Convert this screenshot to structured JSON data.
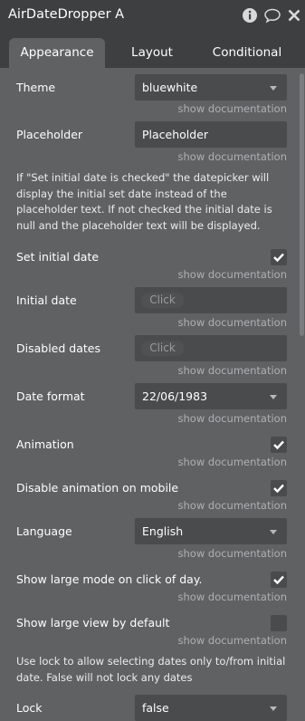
{
  "header": {
    "title": "AirDateDropper A"
  },
  "tabs": [
    {
      "label": "Appearance",
      "active": true
    },
    {
      "label": "Layout",
      "active": false
    },
    {
      "label": "Conditional",
      "active": false
    }
  ],
  "doc_link": "show documentation",
  "fields": {
    "theme": {
      "label": "Theme",
      "value": "bluewhite"
    },
    "placeholder": {
      "label": "Placeholder",
      "value": "Placeholder"
    },
    "placeholder_note": "If \"Set initial date is checked\" the datepicker will display the initial set date instead of the placeholder text. If not checked the initial date is null and the placeholder text will be displayed.",
    "set_initial_date": {
      "label": "Set initial date",
      "checked": true
    },
    "initial_date": {
      "label": "Initial date",
      "button": "Click"
    },
    "disabled_dates": {
      "label": "Disabled dates",
      "button": "Click"
    },
    "date_format": {
      "label": "Date format",
      "value": "22/06/1983"
    },
    "animation": {
      "label": "Animation",
      "checked": true
    },
    "disable_animation_mobile": {
      "label": "Disable animation on mobile",
      "checked": true
    },
    "language": {
      "label": "Language",
      "value": "English"
    },
    "show_large_mode": {
      "label": "Show large mode on click of day.",
      "checked": true
    },
    "show_large_view": {
      "label": "Show large view by default",
      "checked": false
    },
    "lock_note": "Use lock to allow selecting dates only to/from initial date. False will not lock any dates",
    "lock": {
      "label": "Lock",
      "value": "false"
    }
  },
  "colors": {
    "header_bg": "#3e3f41",
    "panel_bg": "#5f6163",
    "field_bg": "#4a4b4d",
    "doc_text": "#aeb0b2"
  }
}
